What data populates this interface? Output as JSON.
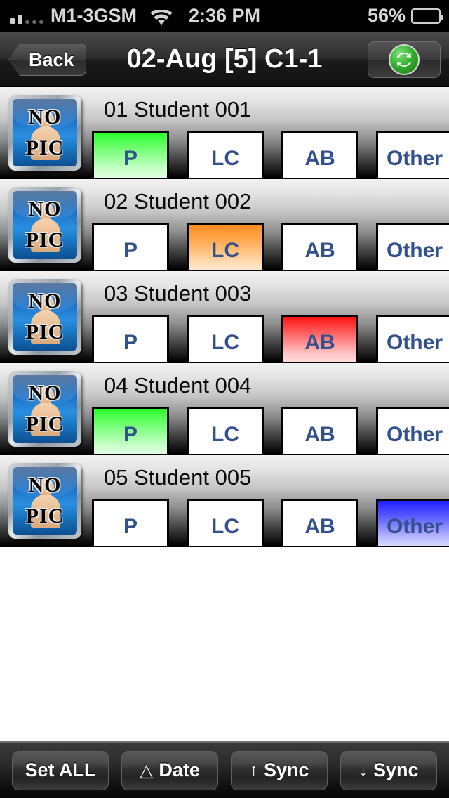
{
  "statusbar": {
    "signal_icon": "signal-bars-icon",
    "carrier": "M1-3GSM",
    "wifi_icon": "wifi-icon",
    "time": "2:36 PM",
    "battery_percent": "56%",
    "battery_icon": "battery-icon",
    "battery_level": 56
  },
  "navbar": {
    "back_label": "Back",
    "title": "02-Aug [5] C1-1",
    "refresh_icon": "refresh-sync-icon"
  },
  "list": {
    "avatar_line1": "NO",
    "avatar_line2": "PIC",
    "avatar_icon": "no-pic-avatar-icon",
    "option_labels": [
      "P",
      "LC",
      "AB",
      "Other"
    ],
    "rows": [
      {
        "name": "01 Student 001",
        "selected": "P"
      },
      {
        "name": "02 Student 002",
        "selected": "LC"
      },
      {
        "name": "03 Student 003",
        "selected": "AB"
      },
      {
        "name": "04 Student 004",
        "selected": "P"
      },
      {
        "name": "05 Student 005",
        "selected": "Other"
      }
    ]
  },
  "toolbar": {
    "set_all_label": "Set ALL",
    "date_icon": "triangle-up-icon",
    "date_label": "Date",
    "sync_up_icon": "arrow-up-icon",
    "sync_up_label": "Sync",
    "sync_down_icon": "arrow-down-icon",
    "sync_down_label": "Sync"
  },
  "colors": {
    "present": "#2bff2b",
    "late_come": "#ff8c1e",
    "absent": "#ff1111",
    "other": "#1d1dff",
    "option_text": "#33518c",
    "accent_green": "#36b030"
  }
}
